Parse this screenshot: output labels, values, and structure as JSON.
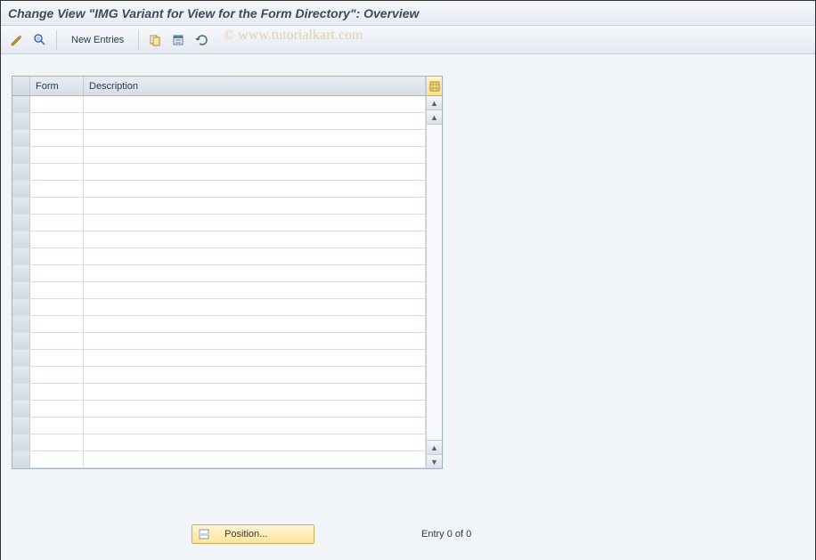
{
  "title": "Change View \"IMG Variant for View for the Form Directory\": Overview",
  "watermark": "© www.tutorialkart.com",
  "toolbar": {
    "new_entries_label": "New Entries"
  },
  "grid": {
    "columns": {
      "form": "Form",
      "description": "Description"
    },
    "rows": [
      {
        "form": "",
        "description": ""
      },
      {
        "form": "",
        "description": ""
      },
      {
        "form": "",
        "description": ""
      },
      {
        "form": "",
        "description": ""
      },
      {
        "form": "",
        "description": ""
      },
      {
        "form": "",
        "description": ""
      },
      {
        "form": "",
        "description": ""
      },
      {
        "form": "",
        "description": ""
      },
      {
        "form": "",
        "description": ""
      },
      {
        "form": "",
        "description": ""
      },
      {
        "form": "",
        "description": ""
      },
      {
        "form": "",
        "description": ""
      },
      {
        "form": "",
        "description": ""
      },
      {
        "form": "",
        "description": ""
      },
      {
        "form": "",
        "description": ""
      },
      {
        "form": "",
        "description": ""
      },
      {
        "form": "",
        "description": ""
      },
      {
        "form": "",
        "description": ""
      },
      {
        "form": "",
        "description": ""
      },
      {
        "form": "",
        "description": ""
      },
      {
        "form": "",
        "description": ""
      },
      {
        "form": "",
        "description": ""
      }
    ]
  },
  "footer": {
    "position_label": "Position...",
    "entry_text": "Entry 0 of 0"
  },
  "colors": {
    "bg_panel": "#f2f5f8",
    "header_text": "#3c4a5a",
    "accent_yellow": "#fce49a"
  }
}
